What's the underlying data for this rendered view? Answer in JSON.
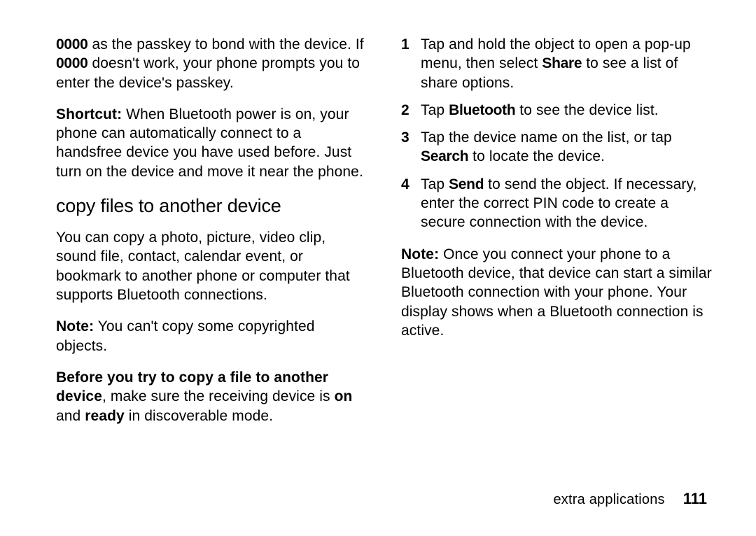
{
  "left": {
    "p1_key": "0000",
    "p1_a": " as the passkey to bond with the device. If ",
    "p1_key2": "0000",
    "p1_b": " doesn't work, your phone prompts you to enter the device's passkey.",
    "p2_label": "Shortcut:",
    "p2_text": " When Bluetooth power is on, your phone can automatically connect to a handsfree device you have used before. Just turn on the device and move it near the phone.",
    "heading": "copy files to another device",
    "p3": "You can copy a photo, picture, video clip, sound file, contact, calendar event, or bookmark to another phone or computer that supports Bluetooth connections.",
    "p4_label": "Note:",
    "p4_text": " You can't copy some copyrighted objects.",
    "p5_a": "Before you try to copy a file to another device",
    "p5_b": ", make sure the receiving device is ",
    "p5_on": "on",
    "p5_c": " and ",
    "p5_ready": "ready",
    "p5_d": " in discoverable mode."
  },
  "right": {
    "steps": [
      {
        "n": "1",
        "a": "Tap and hold the object to open a pop-up menu, then select ",
        "bold1": "Share",
        "b": " to see a list of share options."
      },
      {
        "n": "2",
        "a": "Tap ",
        "bold1": "Bluetooth",
        "b": " to see the device list."
      },
      {
        "n": "3",
        "a": "Tap the device name on the list, or tap ",
        "bold1": "Search",
        "b": " to locate the device."
      },
      {
        "n": "4",
        "a": "Tap ",
        "bold1": "Send",
        "b": " to send the object. If necessary, enter the correct PIN code to create a secure connection with the device."
      }
    ],
    "note_label": "Note:",
    "note_text": " Once you connect your phone to a Bluetooth device, that device can start a similar Bluetooth connection with your phone. Your display shows when a Bluetooth connection is active."
  },
  "footer": {
    "section": "extra applications",
    "page": "111"
  }
}
